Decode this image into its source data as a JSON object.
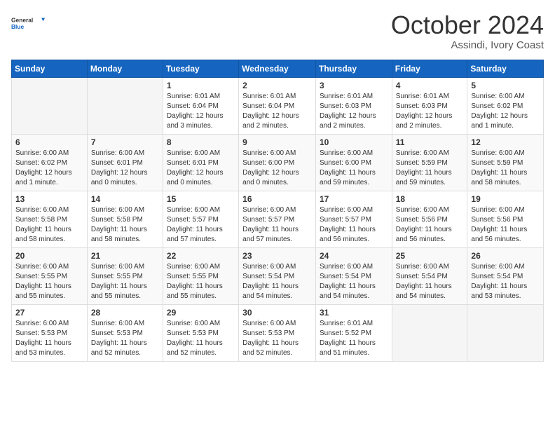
{
  "logo": {
    "general": "General",
    "blue": "Blue"
  },
  "header": {
    "month": "October 2024",
    "location": "Assindi, Ivory Coast"
  },
  "weekdays": [
    "Sunday",
    "Monday",
    "Tuesday",
    "Wednesday",
    "Thursday",
    "Friday",
    "Saturday"
  ],
  "weeks": [
    [
      {
        "day": "",
        "info": ""
      },
      {
        "day": "",
        "info": ""
      },
      {
        "day": "1",
        "info": "Sunrise: 6:01 AM\nSunset: 6:04 PM\nDaylight: 12 hours and 3 minutes."
      },
      {
        "day": "2",
        "info": "Sunrise: 6:01 AM\nSunset: 6:04 PM\nDaylight: 12 hours and 2 minutes."
      },
      {
        "day": "3",
        "info": "Sunrise: 6:01 AM\nSunset: 6:03 PM\nDaylight: 12 hours and 2 minutes."
      },
      {
        "day": "4",
        "info": "Sunrise: 6:01 AM\nSunset: 6:03 PM\nDaylight: 12 hours and 2 minutes."
      },
      {
        "day": "5",
        "info": "Sunrise: 6:00 AM\nSunset: 6:02 PM\nDaylight: 12 hours and 1 minute."
      }
    ],
    [
      {
        "day": "6",
        "info": "Sunrise: 6:00 AM\nSunset: 6:02 PM\nDaylight: 12 hours and 1 minute."
      },
      {
        "day": "7",
        "info": "Sunrise: 6:00 AM\nSunset: 6:01 PM\nDaylight: 12 hours and 0 minutes."
      },
      {
        "day": "8",
        "info": "Sunrise: 6:00 AM\nSunset: 6:01 PM\nDaylight: 12 hours and 0 minutes."
      },
      {
        "day": "9",
        "info": "Sunrise: 6:00 AM\nSunset: 6:00 PM\nDaylight: 12 hours and 0 minutes."
      },
      {
        "day": "10",
        "info": "Sunrise: 6:00 AM\nSunset: 6:00 PM\nDaylight: 11 hours and 59 minutes."
      },
      {
        "day": "11",
        "info": "Sunrise: 6:00 AM\nSunset: 5:59 PM\nDaylight: 11 hours and 59 minutes."
      },
      {
        "day": "12",
        "info": "Sunrise: 6:00 AM\nSunset: 5:59 PM\nDaylight: 11 hours and 58 minutes."
      }
    ],
    [
      {
        "day": "13",
        "info": "Sunrise: 6:00 AM\nSunset: 5:58 PM\nDaylight: 11 hours and 58 minutes."
      },
      {
        "day": "14",
        "info": "Sunrise: 6:00 AM\nSunset: 5:58 PM\nDaylight: 11 hours and 58 minutes."
      },
      {
        "day": "15",
        "info": "Sunrise: 6:00 AM\nSunset: 5:57 PM\nDaylight: 11 hours and 57 minutes."
      },
      {
        "day": "16",
        "info": "Sunrise: 6:00 AM\nSunset: 5:57 PM\nDaylight: 11 hours and 57 minutes."
      },
      {
        "day": "17",
        "info": "Sunrise: 6:00 AM\nSunset: 5:57 PM\nDaylight: 11 hours and 56 minutes."
      },
      {
        "day": "18",
        "info": "Sunrise: 6:00 AM\nSunset: 5:56 PM\nDaylight: 11 hours and 56 minutes."
      },
      {
        "day": "19",
        "info": "Sunrise: 6:00 AM\nSunset: 5:56 PM\nDaylight: 11 hours and 56 minutes."
      }
    ],
    [
      {
        "day": "20",
        "info": "Sunrise: 6:00 AM\nSunset: 5:55 PM\nDaylight: 11 hours and 55 minutes."
      },
      {
        "day": "21",
        "info": "Sunrise: 6:00 AM\nSunset: 5:55 PM\nDaylight: 11 hours and 55 minutes."
      },
      {
        "day": "22",
        "info": "Sunrise: 6:00 AM\nSunset: 5:55 PM\nDaylight: 11 hours and 55 minutes."
      },
      {
        "day": "23",
        "info": "Sunrise: 6:00 AM\nSunset: 5:54 PM\nDaylight: 11 hours and 54 minutes."
      },
      {
        "day": "24",
        "info": "Sunrise: 6:00 AM\nSunset: 5:54 PM\nDaylight: 11 hours and 54 minutes."
      },
      {
        "day": "25",
        "info": "Sunrise: 6:00 AM\nSunset: 5:54 PM\nDaylight: 11 hours and 54 minutes."
      },
      {
        "day": "26",
        "info": "Sunrise: 6:00 AM\nSunset: 5:54 PM\nDaylight: 11 hours and 53 minutes."
      }
    ],
    [
      {
        "day": "27",
        "info": "Sunrise: 6:00 AM\nSunset: 5:53 PM\nDaylight: 11 hours and 53 minutes."
      },
      {
        "day": "28",
        "info": "Sunrise: 6:00 AM\nSunset: 5:53 PM\nDaylight: 11 hours and 52 minutes."
      },
      {
        "day": "29",
        "info": "Sunrise: 6:00 AM\nSunset: 5:53 PM\nDaylight: 11 hours and 52 minutes."
      },
      {
        "day": "30",
        "info": "Sunrise: 6:00 AM\nSunset: 5:53 PM\nDaylight: 11 hours and 52 minutes."
      },
      {
        "day": "31",
        "info": "Sunrise: 6:01 AM\nSunset: 5:52 PM\nDaylight: 11 hours and 51 minutes."
      },
      {
        "day": "",
        "info": ""
      },
      {
        "day": "",
        "info": ""
      }
    ]
  ]
}
